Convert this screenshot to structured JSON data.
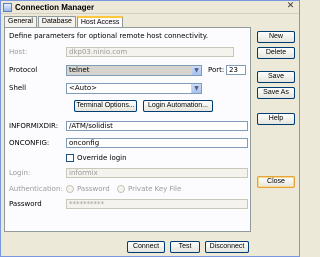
{
  "window": {
    "title": "Connection Manager",
    "close_glyph": "✕"
  },
  "tabs": [
    "General",
    "Database",
    "Host Access"
  ],
  "panel": {
    "description": "Define parameters for optional remote host connectivity.",
    "host": {
      "label": "Host:",
      "value": "dkp03.ninio.com"
    },
    "protocol": {
      "label": "Protocol",
      "value": "telnet"
    },
    "port": {
      "label": "Port:",
      "value": "23"
    },
    "shell": {
      "label": "Shell",
      "value": "<Auto>"
    },
    "terminal_options_label": "Terminal Options...",
    "login_automation_label": "Login Automation...",
    "informixdir": {
      "label": "INFORMIXDIR:",
      "value": "/ATM/solidist"
    },
    "onconfig": {
      "label": "ONCONFIG:",
      "value": "onconfig"
    },
    "override_login_label": "Override login",
    "login": {
      "label": "Login:",
      "value": "informix"
    },
    "authentication": {
      "label": "Authentication:",
      "option_password": "Password",
      "option_private_key": "Private Key File"
    },
    "password": {
      "label": "Password",
      "value": "**********"
    }
  },
  "side_buttons": {
    "new": "New",
    "delete": "Delete",
    "save": "Save",
    "save_as": "Save As",
    "help": "Help",
    "close": "Close"
  },
  "bottom_buttons": {
    "connect": "Connect",
    "test": "Test",
    "disconnect": "Disconnect"
  },
  "icons": {
    "select_arrow": "▼"
  }
}
